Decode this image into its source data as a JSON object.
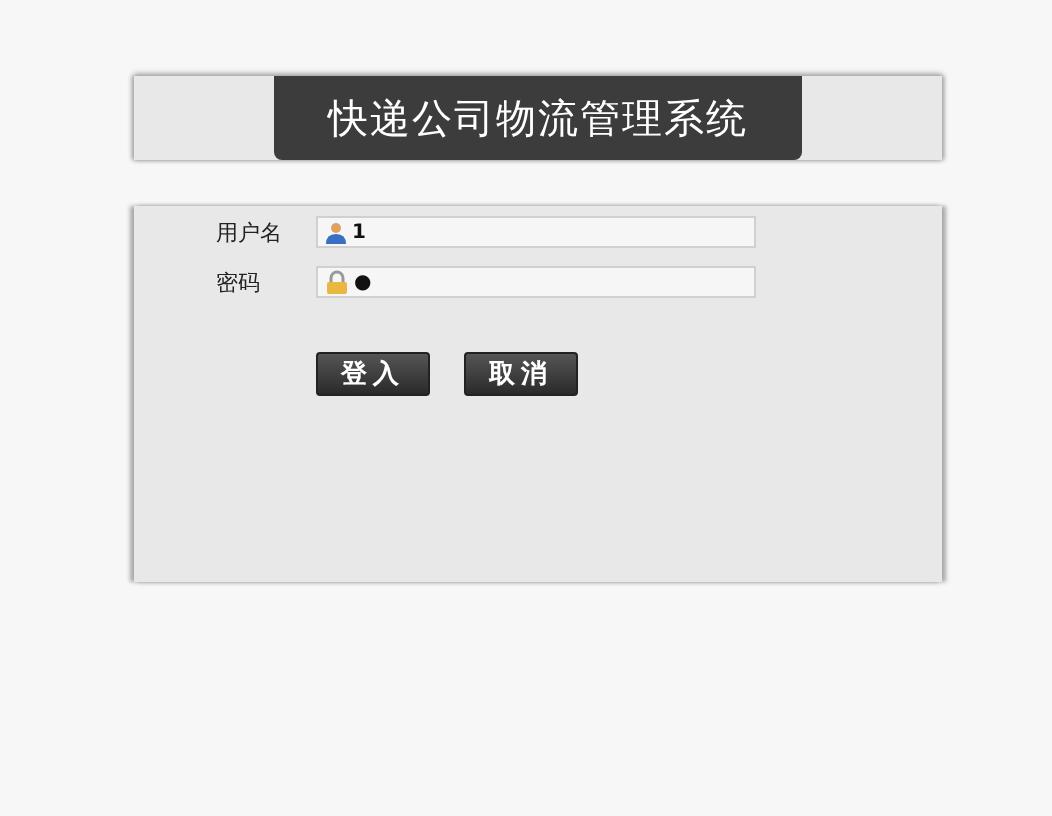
{
  "title": "快递公司物流管理系统",
  "fields": [
    {
      "kind": "user",
      "label": "用户名",
      "value": "1"
    },
    {
      "kind": "password",
      "label": "密码",
      "value": "●"
    }
  ],
  "buttons": [
    {
      "label": "登入"
    },
    {
      "label": "取消"
    }
  ]
}
